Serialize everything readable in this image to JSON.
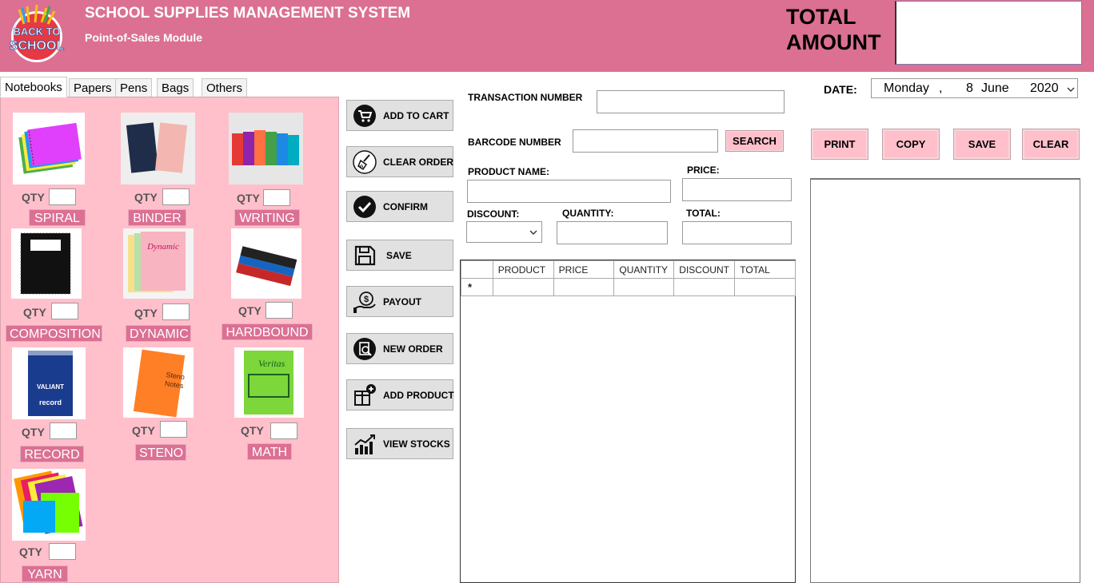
{
  "header": {
    "title": "SCHOOL SUPPLIES MANAGEMENT SYSTEM",
    "subtitle": "Point-of-Sales Module",
    "total_label": "TOTAL AMOUNT",
    "total_value": "",
    "logo_text": "BACK TO SCHOOL",
    "brand_color": "#db7093"
  },
  "tabs": [
    "Notebooks",
    "Papers",
    "Pens",
    "Bags",
    "Others"
  ],
  "active_tab": "Notebooks",
  "products": {
    "qty_label": "QTY",
    "items": [
      {
        "name": "SPIRAL",
        "qty": ""
      },
      {
        "name": "BINDER",
        "qty": ""
      },
      {
        "name": "WRITING",
        "qty": ""
      },
      {
        "name": "COMPOSITION",
        "qty": ""
      },
      {
        "name": "DYNAMIC",
        "qty": ""
      },
      {
        "name": "HARDBOUND",
        "qty": ""
      },
      {
        "name": "RECORD",
        "qty": ""
      },
      {
        "name": "STENO",
        "qty": ""
      },
      {
        "name": "MATH",
        "qty": ""
      },
      {
        "name": "YARN",
        "qty": ""
      }
    ]
  },
  "actions": [
    {
      "label": "ADD TO CART",
      "icon": "cart-icon"
    },
    {
      "label": "CLEAR ORDER",
      "icon": "broom-icon"
    },
    {
      "label": "CONFIRM",
      "icon": "check-circle-icon"
    },
    {
      "label": "SAVE",
      "icon": "floppy-disk-icon"
    },
    {
      "label": "PAYOUT",
      "icon": "payout-icon"
    },
    {
      "label": "NEW ORDER",
      "icon": "search-document-icon"
    },
    {
      "label": "ADD PRODUCT",
      "icon": "add-product-icon"
    },
    {
      "label": "VIEW STOCKS",
      "icon": "stocks-chart-icon"
    }
  ],
  "form": {
    "transaction_label": "TRANSACTION NUMBER",
    "transaction_value": "",
    "barcode_label": "BARCODE NUMBER",
    "barcode_value": "",
    "search_label": "SEARCH",
    "product_name_label": "PRODUCT NAME:",
    "product_name_value": "",
    "price_label": "PRICE:",
    "price_value": "",
    "discount_label": "DISCOUNT:",
    "discount_value": "",
    "quantity_label": "QUANTITY:",
    "quantity_value": "",
    "total_label": "TOTAL:",
    "total_value": ""
  },
  "date": {
    "label": "DATE:",
    "weekday": "Monday",
    "day": "8",
    "month": "June",
    "year": "2020"
  },
  "receipt_buttons": [
    "PRINT",
    "COPY",
    "SAVE",
    "CLEAR"
  ],
  "grid": {
    "columns": [
      "PRODUCT",
      "PRICE",
      "QUANTITY",
      "DISCOUNT",
      "TOTAL"
    ],
    "new_row_marker": "*"
  }
}
